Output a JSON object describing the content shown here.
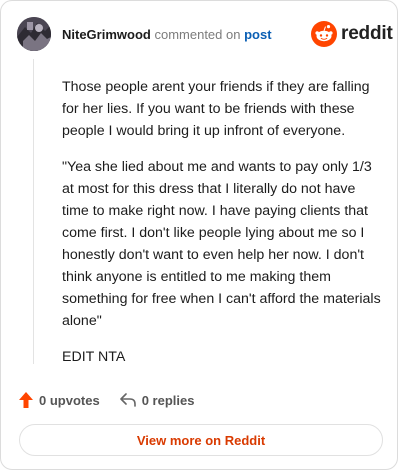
{
  "header": {
    "username": "NiteGrimwood",
    "action_text": "commented on",
    "post_link": "post",
    "logo_text": "reddit"
  },
  "comment": {
    "paragraphs": [
      "Those people arent your friends if they are falling for her lies. If you want to be friends with these people I would bring it up infront of everyone.",
      "\"Yea she lied about me and wants to pay only 1/3 at most for this dress that I literally do not have time to make right now. I have paying clients that come first. I don't like people lying about me so I honestly don't want to even help her now. I don't think anyone is entitled to me making them something for free when I can't afford the materials alone\"",
      "EDIT NTA"
    ]
  },
  "actions": {
    "upvotes": "0 upvotes",
    "replies": "0 replies"
  },
  "footer": {
    "view_more": "View more on Reddit"
  },
  "colors": {
    "upvote": "#ff4500",
    "link": "#0a5fb4",
    "view_more": "#d93a00"
  },
  "icons": {
    "upvote": "upvote-arrow-icon",
    "reply": "reply-arrow-icon",
    "logo": "reddit-snoo-icon"
  }
}
